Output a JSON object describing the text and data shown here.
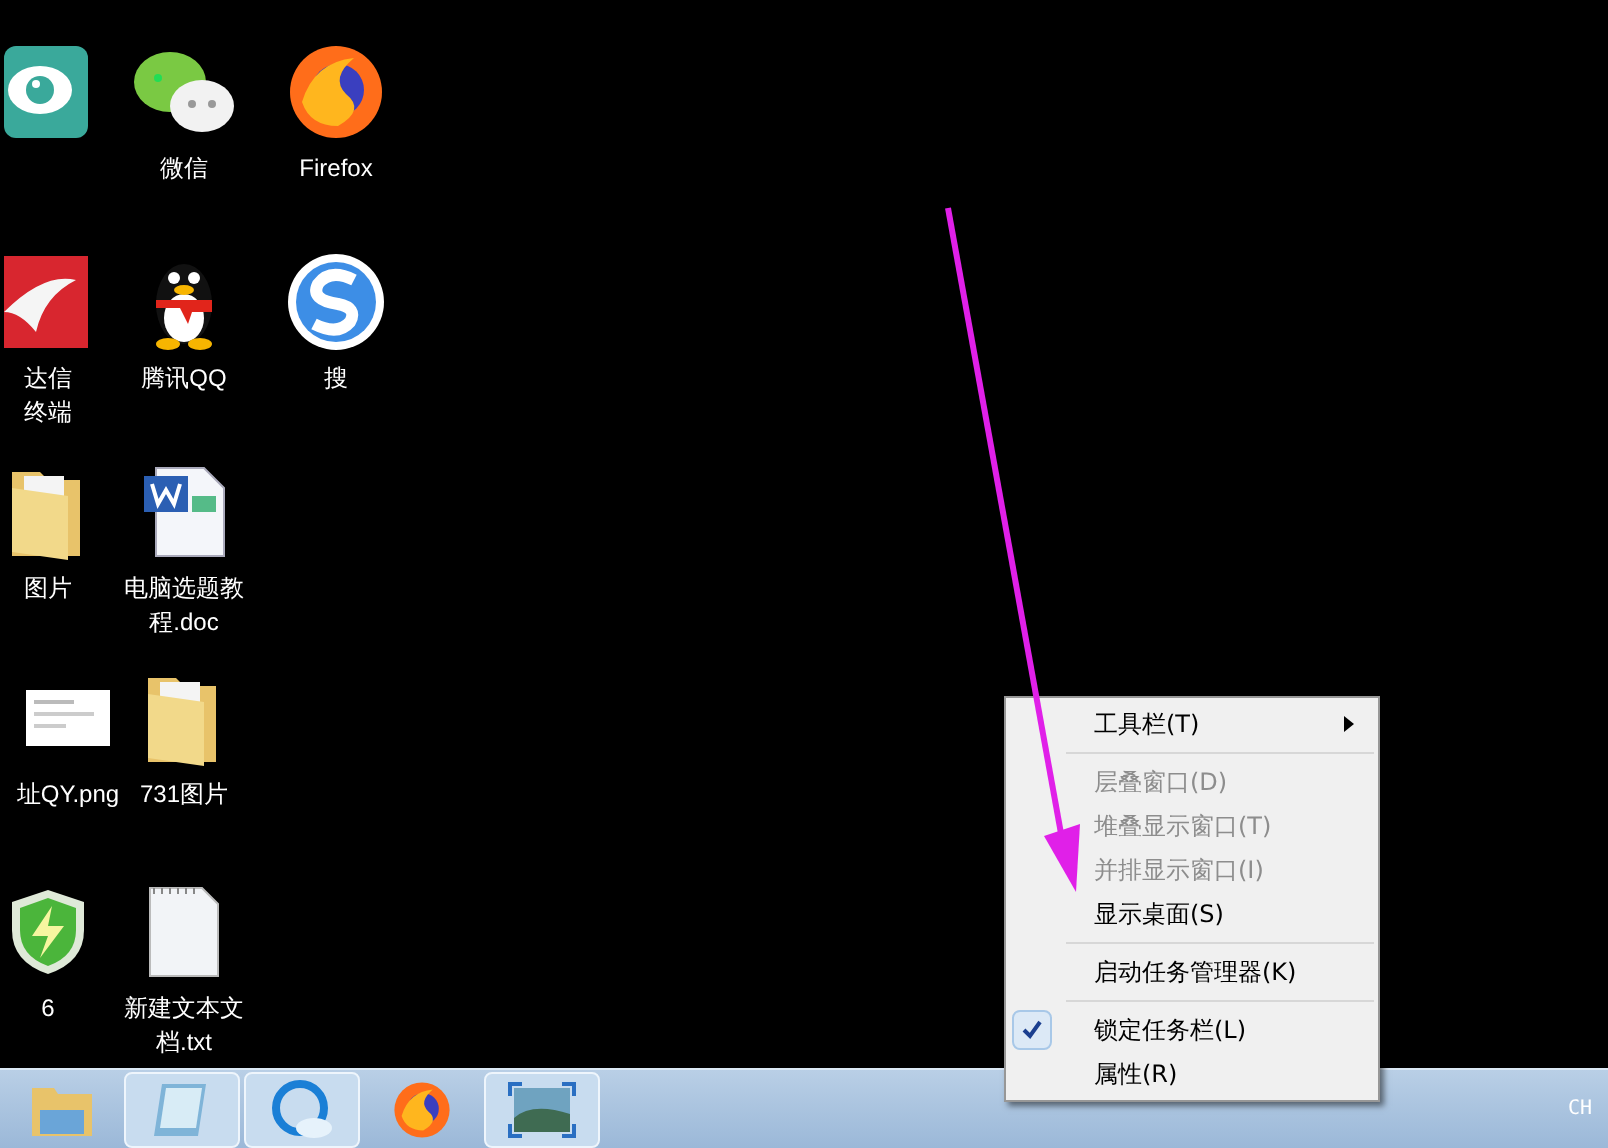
{
  "desktop_icons": [
    {
      "kind": "eye-app"
    },
    {
      "kind": "chat",
      "label": [
        "微信"
      ]
    },
    {
      "kind": "firefox",
      "label": [
        "Firefox"
      ]
    },
    {
      "kind": "swoosh-app",
      "label": [
        "达信",
        "终端"
      ]
    },
    {
      "kind": "penguin",
      "label": [
        "腾讯QQ"
      ]
    },
    {
      "kind": "s-browser",
      "label": [
        "搜"
      ]
    },
    {
      "kind": "folder",
      "label": [
        "图片"
      ]
    },
    {
      "kind": "word",
      "label": [
        "电脑选题教",
        "程.doc"
      ]
    },
    {
      "kind": "image",
      "label": [
        "址QY.png"
      ]
    },
    {
      "kind": "folder",
      "label": [
        "731图片"
      ]
    },
    {
      "kind": "shield",
      "label": [
        "6"
      ]
    },
    {
      "kind": "text-file",
      "label": [
        "新建文本文",
        "档.txt"
      ]
    }
  ],
  "taskbar": {
    "buttons": [
      {
        "kind": "folder",
        "selected": false
      },
      {
        "kind": "notepad",
        "selected": true
      },
      {
        "kind": "browser",
        "selected": true
      },
      {
        "kind": "firefox",
        "selected": false
      },
      {
        "kind": "photo",
        "selected": true
      }
    ],
    "language": "CH"
  },
  "context_menu": [
    {
      "kind": "submenu",
      "label": "工具栏(T)",
      "disabled": false,
      "checked": false
    },
    {
      "kind": "separator"
    },
    {
      "kind": "item",
      "label": "层叠窗口(D)",
      "disabled": true,
      "checked": false
    },
    {
      "kind": "item",
      "label": "堆叠显示窗口(T)",
      "disabled": true,
      "checked": false
    },
    {
      "kind": "item",
      "label": "并排显示窗口(I)",
      "disabled": true,
      "checked": false
    },
    {
      "kind": "item",
      "label": "显示桌面(S)",
      "disabled": false,
      "checked": false
    },
    {
      "kind": "separator"
    },
    {
      "kind": "item",
      "label": "启动任务管理器(K)",
      "disabled": false,
      "checked": false
    },
    {
      "kind": "separator"
    },
    {
      "kind": "item",
      "label": "锁定任务栏(L)",
      "disabled": false,
      "checked": true
    },
    {
      "kind": "item",
      "label": "属性(R)",
      "disabled": false,
      "checked": false
    }
  ]
}
